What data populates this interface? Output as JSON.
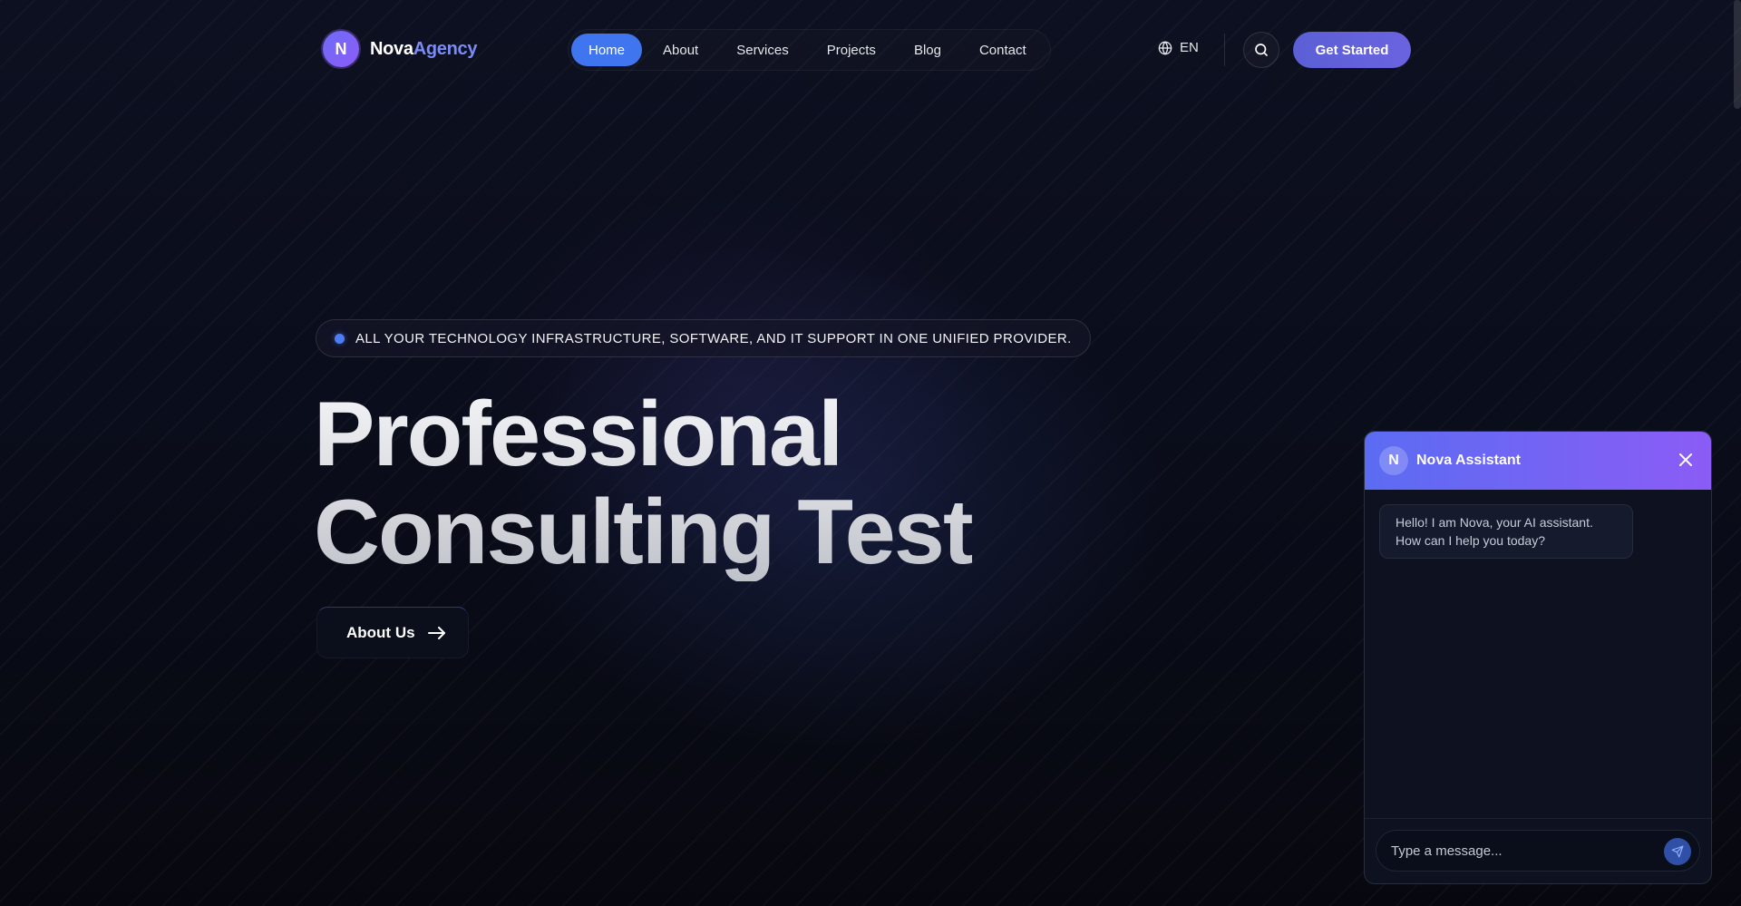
{
  "header": {
    "logo_letter": "N",
    "logo_name_primary": "Nova",
    "logo_name_secondary": "Agency",
    "nav": [
      {
        "label": "Home",
        "active": true
      },
      {
        "label": "About"
      },
      {
        "label": "Services"
      },
      {
        "label": "Projects"
      },
      {
        "label": "Blog"
      },
      {
        "label": "Contact"
      }
    ],
    "language": "EN",
    "cta_label": "Get Started",
    "icons": [
      "globe-icon",
      "search-icon"
    ]
  },
  "hero": {
    "badge_text": "ALL YOUR TECHNOLOGY INFRASTRUCTURE, SOFTWARE, AND IT SUPPORT IN ONE UNIFIED PROVIDER.",
    "title_line1": "Professional",
    "title_line2": "Consulting Test",
    "button_label": "About Us",
    "button_icon": "arrow-right-icon"
  },
  "chat": {
    "avatar_letter": "N",
    "title": "Nova Assistant",
    "close_icon": "close-icon",
    "messages": [
      {
        "from": "assistant",
        "text": "Hello! I am Nova, your AI assistant. How can I help you today?"
      }
    ],
    "input_placeholder": "Type a message...",
    "send_icon": "send-icon"
  },
  "colors": {
    "background": "#080a14",
    "accent_blue": "#3f76f0",
    "accent_purple": "#8b5cf6",
    "cta": "#5b5fd6"
  }
}
